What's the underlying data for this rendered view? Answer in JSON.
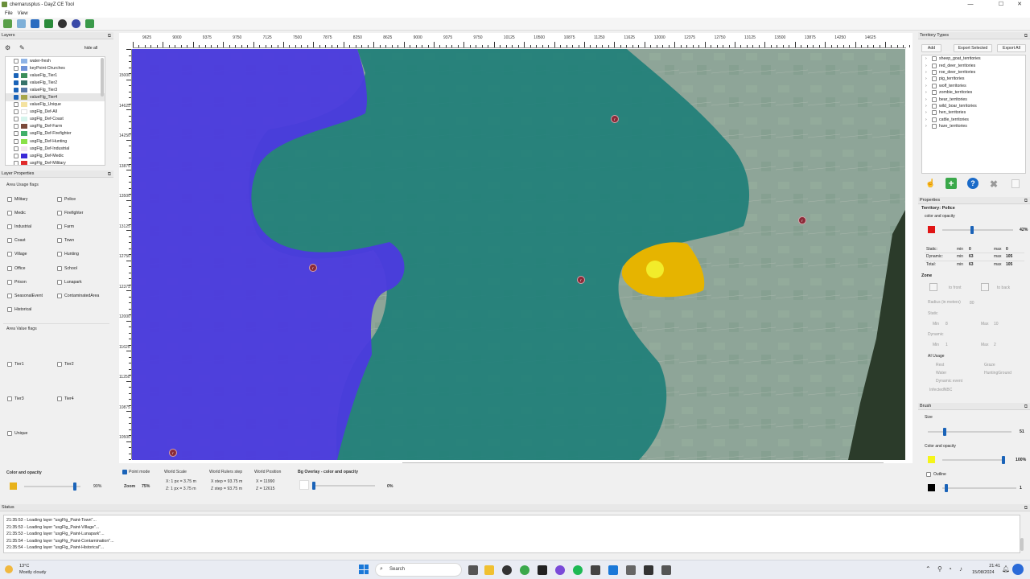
{
  "window": {
    "title": "chernarusplus - DayZ CE Tool",
    "controls": [
      "—",
      "☐",
      "✕"
    ]
  },
  "menu": [
    "File",
    "View"
  ],
  "layers": {
    "header": "Layers",
    "hide_all": "hide all",
    "items": [
      {
        "label": "water-fresh",
        "checked": false,
        "color": "#8fb4e6"
      },
      {
        "label": "keyPoint-Churches",
        "checked": false,
        "color": "#6f93d8"
      },
      {
        "label": "valueFlg_Tier1",
        "checked": true,
        "color": "#3c8f5a"
      },
      {
        "label": "valueFlg_Tier2",
        "checked": true,
        "color": "#36736a"
      },
      {
        "label": "valueFlg_Tier3",
        "checked": true,
        "color": "#5a7aa8"
      },
      {
        "label": "valueFlg_Tier4",
        "checked": true,
        "color": "#a7a64a"
      },
      {
        "label": "valueFlg_Unique",
        "checked": false,
        "color": "#f4e2a0"
      },
      {
        "label": "usgFlg_Def-All",
        "checked": false,
        "color": "#ffffff"
      },
      {
        "label": "usgFlg_Def-Coast",
        "checked": false,
        "color": "#d6f4ec"
      },
      {
        "label": "usgFlg_Def-Farm",
        "checked": false,
        "color": "#7a4a3a"
      },
      {
        "label": "usgFlg_Def-Firefighter",
        "checked": false,
        "color": "#41b06a"
      },
      {
        "label": "usgFlg_Def-Hunting",
        "checked": false,
        "color": "#8ae04a"
      },
      {
        "label": "usgFlg_Def-Industrial",
        "checked": false,
        "color": "#f2e6f0"
      },
      {
        "label": "usgFlg_Def-Medic",
        "checked": false,
        "color": "#3a2ad8"
      },
      {
        "label": "usgFlg_Def-Military",
        "checked": false,
        "color": "#e02a2a"
      }
    ]
  },
  "layer_properties": {
    "header": "Layer Properties",
    "usage_title": "Area Usage flags",
    "usage_left": [
      "Military",
      "Medic",
      "Industrial",
      "Coast",
      "Village",
      "Office",
      "Prison",
      "SeasonalEvent",
      "Historical"
    ],
    "usage_right": [
      "Police",
      "Firefighter",
      "Farm",
      "Town",
      "Hunting",
      "School",
      "Lunapark",
      "ContaminatedArea"
    ],
    "value_title": "Area Value flags",
    "value_left": [
      "Tier1",
      "Tier3",
      "Unique"
    ],
    "value_right": [
      "Tier2",
      "Tier4"
    ],
    "color_title": "Color and opacity",
    "color": "#e8b21a",
    "opacity": "90%",
    "opacity_fraction": 0.9
  },
  "map": {
    "x_ticks": [
      "9625",
      "9000",
      "9375",
      "9750",
      "7125",
      "7500",
      "7875",
      "8250",
      "8625",
      "9000",
      "9375",
      "9750",
      "10125",
      "10500",
      "10875",
      "11250",
      "11625",
      "12000",
      "12375",
      "12750",
      "13125",
      "13500",
      "13875",
      "14250",
      "14625"
    ],
    "y_ticks": [
      "15000",
      "14625",
      "14250",
      "13875",
      "13500",
      "13125",
      "12750",
      "12375",
      "12000",
      "11625",
      "11250",
      "10875",
      "10500"
    ],
    "marker_glyph": "r"
  },
  "map_info": {
    "point_mode": "Point mode",
    "zoom_label": "Zoom",
    "zoom_value": "75%",
    "world_scale_title": "World Scale",
    "scale_x": "X: 1 px = 3.75 m",
    "scale_z": "Z: 1 px = 3.75 m",
    "rulers_title": "World Rulers step",
    "step_x": "X step = 93.75 m",
    "step_z": "Z step = 93.75 m",
    "position_title": "World Position",
    "pos_x": "X = 11990",
    "pos_z": "Z = 12615",
    "overlay_title": "Bg Overlay - color and opacity",
    "overlay_value": "0%",
    "overlay_fraction": 0.0
  },
  "territory_types": {
    "header": "Territory Types",
    "add": "Add",
    "export_selected": "Export Selected",
    "export_all": "Export All",
    "items": [
      "sheep_goat_territories",
      "red_deer_territories",
      "roe_deer_territories",
      "pig_territories",
      "wolf_territories",
      "zombie_territories",
      "bear_territories",
      "wild_boar_territories",
      "hen_territories",
      "cattle_territories",
      "hare_territories"
    ]
  },
  "properties": {
    "header": "Properties",
    "territory": "Territory: Police",
    "color_label": "color and opacity",
    "color": "#e01515",
    "opacity": "42%",
    "opacity_fraction": 0.42,
    "static_label": "Static:",
    "dynamic_label": "Dynamic:",
    "total_label": "Total:",
    "min_label": "min",
    "max_label": "max",
    "static_min": "0",
    "static_max": "0",
    "dynamic_min": "63",
    "dynamic_max": "105",
    "total_min": "63",
    "total_max": "105",
    "zone_title": "Zone",
    "to_front": "to front",
    "to_back": "to back",
    "radius_label": "Radius (in meters)",
    "radius_value": "80",
    "static_title": "Static",
    "dynamic_title": "Dynamic",
    "s_min": "Min",
    "s_min_val": "8",
    "s_max": "Max",
    "s_max_val": "10",
    "d_min": "Min",
    "d_min_val": "1",
    "d_max": "Max",
    "d_max_val": "2",
    "ai_title": "AI Usage",
    "ai_rest": "Rest",
    "ai_graze": "Graze",
    "ai_water": "Water",
    "ai_hunting": "HuntingGround",
    "ai_dynamic": "Dynamic event",
    "ai_infected": "InfectedNBC"
  },
  "brush": {
    "header": "Brush",
    "size_label": "Size",
    "size_value": "51",
    "size_fraction": 0.2,
    "color_label": "Color and opacity",
    "color": "#f5f51a",
    "opacity": "100%",
    "opacity_fraction": 1.0,
    "outline_label": "Outline",
    "outline_color": "#000000",
    "outline_value": "1",
    "outline_fraction": 0.05
  },
  "status": {
    "header": "Status",
    "lines": [
      "21:35:53 - Loading layer \"usgFlg_Paint-Town\"...",
      "21:35:53 - Loading layer \"usgFlg_Paint-Village\"...",
      "21:35:53 - Loading layer \"usgFlg_Paint-Lunapark\"...",
      "21:35:54 - Loading layer \"usgFlg_Paint-Contamination\"...",
      "21:35:54 - Loading layer \"usgFlg_Paint-Historical\"..."
    ]
  },
  "taskbar": {
    "weather_temp": "13°C",
    "weather_desc": "Mostly cloudy",
    "search": "Search",
    "time": "21:41",
    "date": "15/08/2024"
  }
}
